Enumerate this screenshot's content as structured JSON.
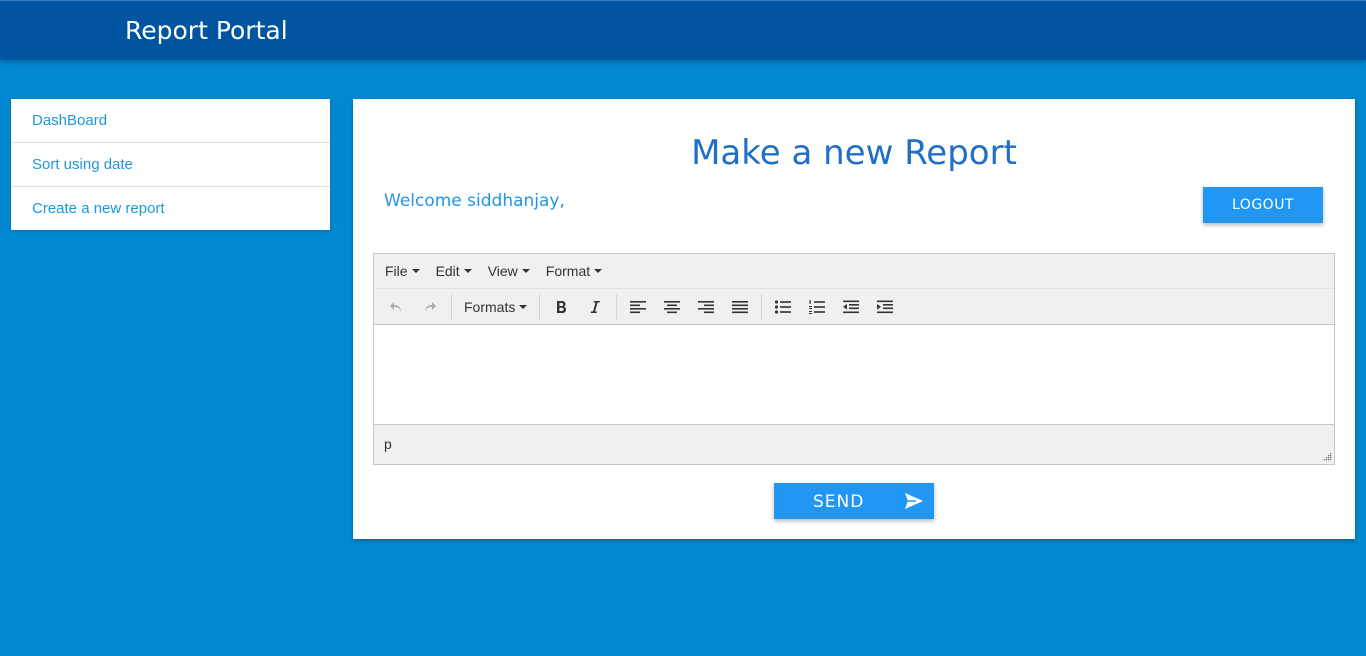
{
  "header": {
    "title": "Report Portal"
  },
  "sidebar": {
    "items": [
      {
        "label": "DashBoard"
      },
      {
        "label": "Sort using date"
      },
      {
        "label": "Create a new report"
      }
    ]
  },
  "main": {
    "title": "Make a new Report",
    "welcome": "Welcome siddhanjay,",
    "logout_label": "LOGOUT",
    "send_label": "SEND"
  },
  "editor": {
    "menus": [
      "File",
      "Edit",
      "View",
      "Format"
    ],
    "formats_label": "Formats",
    "status_path": "p",
    "icons": [
      "undo-icon",
      "redo-icon",
      "bold-icon",
      "italic-icon",
      "align-left-icon",
      "align-center-icon",
      "align-right-icon",
      "align-justify-icon",
      "bullet-list-icon",
      "numbered-list-icon",
      "outdent-icon",
      "indent-icon",
      "resize-handle-icon"
    ]
  },
  "colors": {
    "header_bg": "#0155a0",
    "page_bg": "#0288d1",
    "accent": "#2196f3",
    "title": "#1f6fc7",
    "link": "#1e98db"
  }
}
